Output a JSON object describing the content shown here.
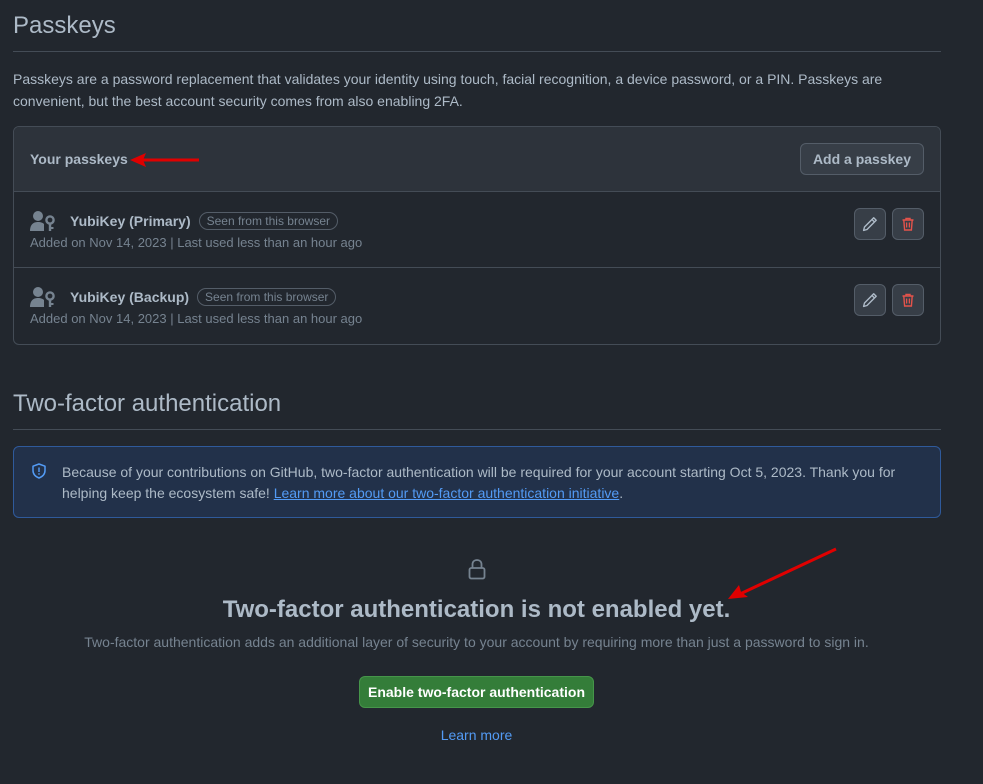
{
  "passkeys": {
    "title": "Passkeys",
    "description": "Passkeys are a password replacement that validates your identity using touch, facial recognition, a device password, or a PIN. Passkeys are convenient, but the best account security comes from also enabling 2FA.",
    "list_title": "Your passkeys",
    "add_button": "Add a passkey",
    "items": [
      {
        "name": "YubiKey (Primary)",
        "badge": "Seen from this browser",
        "meta": "Added on Nov 14, 2023 | Last used less than an hour ago"
      },
      {
        "name": "YubiKey (Backup)",
        "badge": "Seen from this browser",
        "meta": "Added on Nov 14, 2023 | Last used less than an hour ago"
      }
    ]
  },
  "two_factor": {
    "title": "Two-factor authentication",
    "notice_text": "Because of your contributions on GitHub, two-factor authentication will be required for your account starting Oct 5, 2023. Thank you for helping keep the ecosystem safe! ",
    "notice_link": "Learn more about our two-factor authentication initiative",
    "notice_end": ".",
    "blank_title": "Two-factor authentication is not enabled yet.",
    "blank_desc": "Two-factor authentication adds an additional layer of security to your account by requiring more than just a password to sign in.",
    "enable_button": "Enable two-factor authentication",
    "learn_more": "Learn more"
  },
  "colors": {
    "background": "#22272e",
    "accent_link": "#539bf5",
    "primary_button": "#347d39",
    "danger_icon": "#e5534b",
    "annotation_arrow": "#e00000"
  },
  "icons": [
    "passkey-icon",
    "pencil-icon",
    "trash-icon",
    "shield-icon",
    "lock-icon"
  ]
}
